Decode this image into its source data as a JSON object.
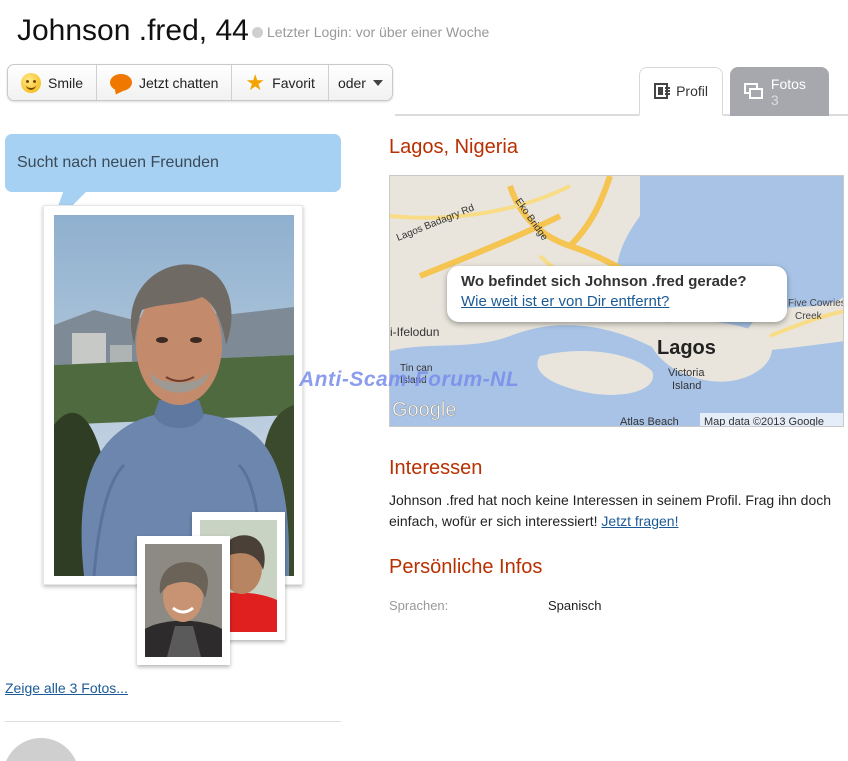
{
  "header": {
    "name_age": "Johnson .fred, 44",
    "last_login": "Letzter Login: vor über einer Woche"
  },
  "actions": {
    "smile": "Smile",
    "chat": "Jetzt chatten",
    "favorite": "Favorit",
    "more": "oder"
  },
  "tabs": {
    "profile": "Profil",
    "photos": "Fotos",
    "photos_count": "3"
  },
  "sidebar": {
    "status_bubble": "Sucht nach neuen Freunden",
    "show_all_photos": "Zeige alle 3 Fotos..."
  },
  "location": {
    "city": "Lagos, Nigeria"
  },
  "map": {
    "popup_question": "Wo befindet sich Johnson .fred gerade?",
    "popup_link": "Wie weit ist er von Dir entfernt?",
    "labels": {
      "badagry_rd": "Lagos Badagry Rd",
      "eko_bridge": "Eko Bridge",
      "ifelodun": "i-Ifelodun",
      "tin_can": "Tin can",
      "island": "Island",
      "lagos": "Lagos",
      "victoria": "Victoria",
      "victoria_island": "Island",
      "cowries": "Five Cowries",
      "creek": "Creek",
      "atlas_beach": "Atlas Beach",
      "map_data": "Map data ©2013 Google",
      "google": "Google"
    }
  },
  "watermark": "Anti-Scam-Forum-NL",
  "interests": {
    "title": "Interessen",
    "text": "Johnson .fred hat noch keine Interessen in seinem Profil. Frag ihn doch einfach, wofür er sich interessiert!",
    "link": "Jetzt fragen!"
  },
  "personal": {
    "title": "Persönliche Infos",
    "languages_label": "Sprachen:",
    "languages_value": "Spanisch"
  },
  "colors": {
    "accent_red": "#b83000",
    "link_blue": "#1b5a96",
    "bubble_blue": "#a7d1f2",
    "tab_inactive": "#a7a8ae"
  }
}
